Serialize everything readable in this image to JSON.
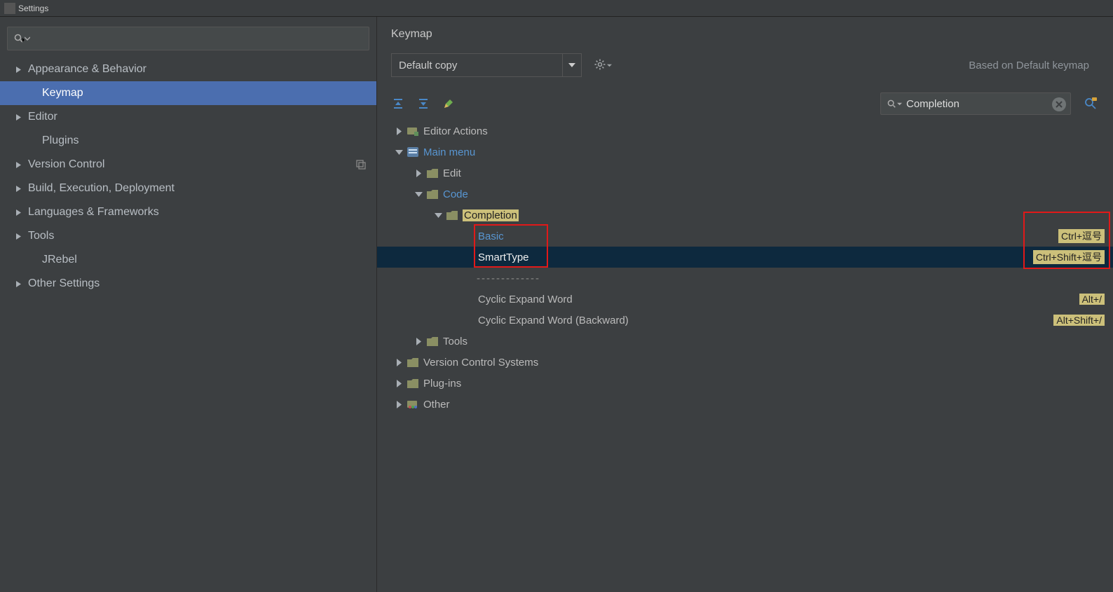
{
  "window": {
    "title": "Settings"
  },
  "sidebar": {
    "items": [
      {
        "label": "Appearance & Behavior",
        "expandable": true
      },
      {
        "label": "Keymap",
        "expandable": false,
        "selected": true,
        "indent": true
      },
      {
        "label": "Editor",
        "expandable": true
      },
      {
        "label": "Plugins",
        "expandable": false,
        "indent": true
      },
      {
        "label": "Version Control",
        "expandable": true,
        "copyIcon": true
      },
      {
        "label": "Build, Execution, Deployment",
        "expandable": true
      },
      {
        "label": "Languages & Frameworks",
        "expandable": true
      },
      {
        "label": "Tools",
        "expandable": true
      },
      {
        "label": "JRebel",
        "expandable": false,
        "indent": true
      },
      {
        "label": "Other Settings",
        "expandable": true
      }
    ]
  },
  "main": {
    "heading": "Keymap",
    "combo_label": "Default copy",
    "based_on": "Based on Default keymap",
    "action_search_value": "Completion"
  },
  "tree": {
    "rows": [
      {
        "type": "branch",
        "depth": 0,
        "expanded": false,
        "icon": "editor-actions",
        "label": "Editor Actions"
      },
      {
        "type": "branch",
        "depth": 0,
        "expanded": true,
        "icon": "menu",
        "label": "Main menu",
        "link": true
      },
      {
        "type": "branch",
        "depth": 1,
        "expanded": false,
        "icon": "folder",
        "label": "Edit"
      },
      {
        "type": "branch",
        "depth": 1,
        "expanded": true,
        "icon": "folder",
        "label": "Code",
        "link": true
      },
      {
        "type": "branch",
        "depth": 2,
        "expanded": true,
        "icon": "folder",
        "label": "Completion",
        "highlight": true
      },
      {
        "type": "leaf",
        "depth": 3,
        "label": "Basic",
        "link": true,
        "shortcut": "Ctrl+逗号"
      },
      {
        "type": "leaf",
        "depth": 3,
        "label": "SmartType",
        "selected": true,
        "shortcut": "Ctrl+Shift+逗号"
      },
      {
        "type": "sep",
        "depth": 3,
        "label": "-------------"
      },
      {
        "type": "leaf",
        "depth": 3,
        "label": "Cyclic Expand Word",
        "shortcut": "Alt+/"
      },
      {
        "type": "leaf",
        "depth": 3,
        "label": "Cyclic Expand Word (Backward)",
        "shortcut": "Alt+Shift+/"
      },
      {
        "type": "branch",
        "depth": 1,
        "expanded": false,
        "icon": "folder",
        "label": "Tools"
      },
      {
        "type": "branch",
        "depth": 0,
        "expanded": false,
        "icon": "folder",
        "label": "Version Control Systems"
      },
      {
        "type": "branch",
        "depth": 0,
        "expanded": false,
        "icon": "folder",
        "label": "Plug-ins"
      },
      {
        "type": "branch",
        "depth": 0,
        "expanded": false,
        "icon": "other",
        "label": "Other"
      }
    ]
  }
}
